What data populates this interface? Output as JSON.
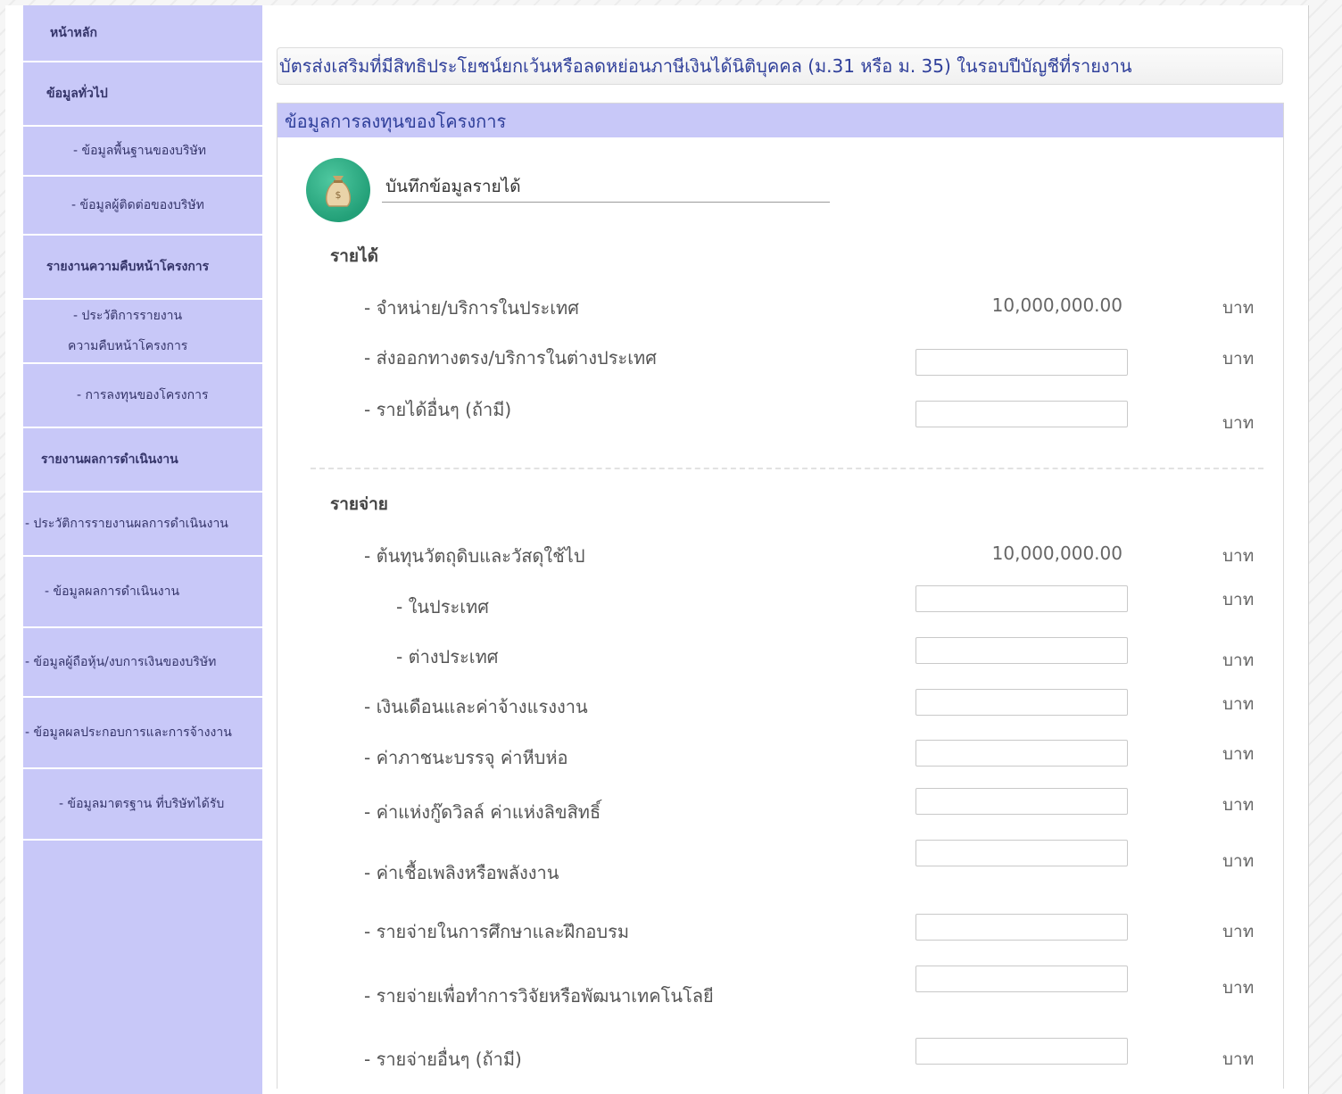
{
  "sidebar": {
    "items": [
      {
        "label": "หน้าหลัก"
      },
      {
        "label": "ข้อมูลทั่วไป"
      },
      {
        "label": "- ข้อมูลพื้นฐานของบริษัท"
      },
      {
        "label": "- ข้อมูลผู้ติดต่อของบริษัท"
      },
      {
        "label": "รายงานความคืบหน้าโครงการ"
      },
      {
        "label": "- ประวัติการรายงาน"
      },
      {
        "label": "ความคืบหน้าโครงการ"
      },
      {
        "label": "- การลงทุนของโครงการ"
      },
      {
        "label": "รายงานผลการดำเนินงาน"
      },
      {
        "label": "- ประวัติการรายงานผลการดำเนินงาน"
      },
      {
        "label": "- ข้อมูลผลการดำเนินงาน"
      },
      {
        "label": "- ข้อมูลผู้ถือหุ้น/งบการเงินของบริษัท"
      },
      {
        "label": "- ข้อมูลผลประกอบการและการจ้างงาน"
      },
      {
        "label": "- ข้อมูลมาตรฐาน ที่บริษัทได้รับ"
      }
    ]
  },
  "main": {
    "title": "บัตรส่งเสริมที่มีสิทธิประโยชน์ยกเว้นหรือลดหย่อนภาษีเงินได้นิติบุคคล (ม.31 หรือ ม. 35) ในรอบปีบัญชีที่รายงาน",
    "panel_title": "ข้อมูลการลงทุนของโครงการ",
    "record_label": "บันทึกข้อมูลรายได้",
    "icon": "money-bag-icon",
    "unit": "บาท",
    "income": {
      "heading": "รายได้",
      "rows": [
        {
          "label": "- จำหน่าย/บริการในประเทศ",
          "value": "10,000,000.00"
        },
        {
          "label": "- ส่งออกทางตรง/บริการในต่างประเทศ",
          "value": ""
        },
        {
          "label": "- รายได้อื่นๆ (ถ้ามี)",
          "value": ""
        }
      ]
    },
    "expense": {
      "heading": "รายจ่าย",
      "rows": [
        {
          "label": "- ต้นทุนวัตถุดิบและวัสดุใช้ไป",
          "value": "10,000,000.00"
        },
        {
          "label": "- ในประเทศ",
          "value": ""
        },
        {
          "label": "- ต่างประเทศ",
          "value": ""
        },
        {
          "label": "- เงินเดือนและค่าจ้างแรงงาน",
          "value": ""
        },
        {
          "label": "- ค่าภาชนะบรรจุ ค่าหีบห่อ",
          "value": ""
        },
        {
          "label": "- ค่าแห่งกู๊ดวิลล์ ค่าแห่งลิขสิทธิ์",
          "value": ""
        },
        {
          "label": "- ค่าเชื้อเพลิงหรือพลังงาน",
          "value": ""
        },
        {
          "label": "- รายจ่ายในการศึกษาและฝึกอบรม",
          "value": ""
        },
        {
          "label": "- รายจ่ายเพื่อทำการวิจัยหรือพัฒนาเทคโนโลยี",
          "value": ""
        },
        {
          "label": "- รายจ่ายอื่นๆ (ถ้ามี)",
          "value": ""
        }
      ]
    }
  }
}
